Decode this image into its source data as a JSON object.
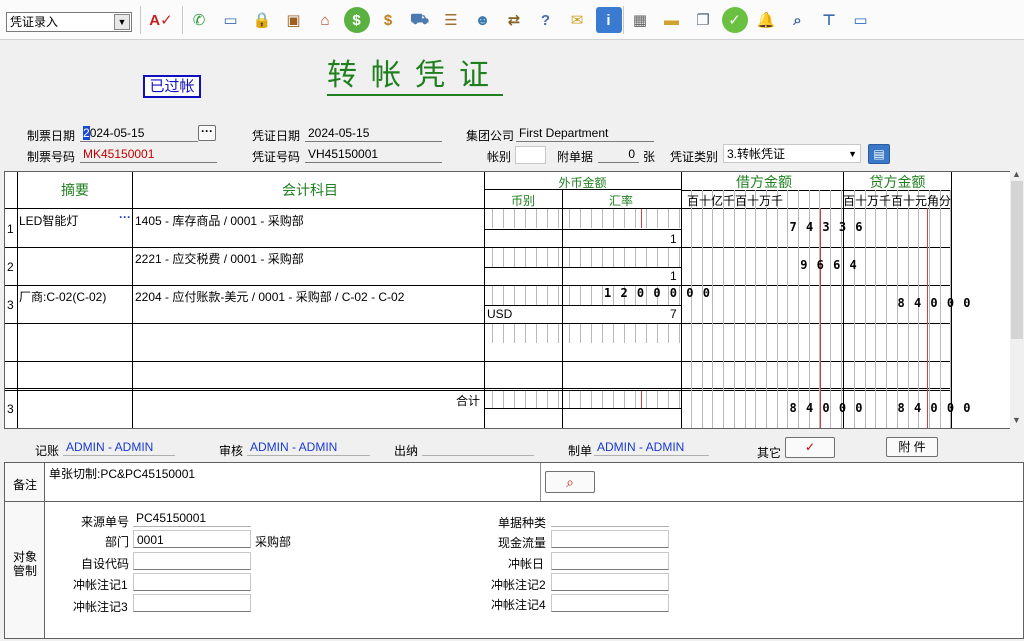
{
  "toolbar": {
    "mode_select": "凭证录入",
    "icons": [
      "spellcheck-icon",
      "phone-icon",
      "computer-icon",
      "lock-icon",
      "briefcase-icon",
      "home-icon",
      "dollar-icon",
      "money-bag-icon",
      "cart-icon",
      "clipboard-icon",
      "users-icon",
      "link-icon",
      "help-doc-icon",
      "mail-icon",
      "info-icon",
      "calculator-icon",
      "folder-icon",
      "copy-icon",
      "check-icon",
      "bell-icon",
      "search-icon",
      "org-tree-icon",
      "monitor-icon"
    ]
  },
  "voucher": {
    "status_stamp": "已过帐",
    "title": "转帐凭证",
    "labels": {
      "made_date": "制票日期",
      "voucher_date": "凭证日期",
      "group_company": "集团公司",
      "made_no": "制票号码",
      "voucher_no": "凭证号码",
      "account_book": "帐别",
      "attachments": "附单据",
      "attachments_unit": "张",
      "voucher_type": "凭证类别"
    },
    "made_date": "2024-05-15",
    "voucher_date": "2024-05-15",
    "group_company": "First Department",
    "made_no": "MK45150001",
    "voucher_no": "VH45150001",
    "account_book": "",
    "attachments": "0",
    "voucher_type": "3.转帐凭证"
  },
  "grid": {
    "headers": {
      "summary": "摘要",
      "account": "会计科目",
      "foreign": "外币金额",
      "currency": "币别",
      "rate": "汇率",
      "debit": "借方金额",
      "credit": "贷方金额",
      "debit_units": "百十亿千百十万千",
      "credit_units": "百十万千百十元角分"
    },
    "rows": [
      {
        "no": "1",
        "summary": "LED智能灯",
        "account": "1405 - 库存商品 / 0001 - 采购部",
        "currency": "",
        "rate": "1",
        "foreign_amount": "",
        "debit": "74336",
        "credit": ""
      },
      {
        "no": "2",
        "summary": "",
        "account": "2221 - 应交税费 / 0001 - 采购部",
        "currency": "",
        "rate": "1",
        "foreign_amount": "",
        "debit": "9664",
        "credit": ""
      },
      {
        "no": "3",
        "summary": "厂商:C-02(C-02)",
        "account": "2204 - 应付账款-美元 / 0001 - 采购部 / C-02 - C-02",
        "currency": "USD",
        "rate": "7",
        "foreign_amount": "1200000",
        "debit": "",
        "credit": "84000"
      }
    ],
    "total": {
      "no": "3",
      "label": "合计",
      "debit": "84000",
      "credit": "84000"
    }
  },
  "signoff": {
    "labels": {
      "bookkeeper": "记账",
      "auditor": "审核",
      "cashier": "出纳",
      "maker": "制单",
      "other": "其它",
      "attach_button": "附  件"
    },
    "bookkeeper": "ADMIN - ADMIN",
    "auditor": "ADMIN - ADMIN",
    "cashier": "",
    "maker": "ADMIN - ADMIN",
    "other_check": "✓"
  },
  "remark": {
    "label": "备注",
    "text": "单张切制:PC&PC45150001"
  },
  "object": {
    "label_line1": "对象",
    "label_line2": "管制",
    "labels": {
      "source_no": "来源单号",
      "department": "部门",
      "custom_code": "自设代码",
      "writeoff1": "冲帐注记1",
      "writeoff3": "冲帐注记3",
      "doc_type": "单据种类",
      "cash_flow": "现金流量",
      "writeoff_date": "冲帐日",
      "writeoff2": "冲帐注记2",
      "writeoff4": "冲帐注记4"
    },
    "source_no": "PC45150001",
    "department_code": "0001",
    "department_name": "采购部"
  }
}
